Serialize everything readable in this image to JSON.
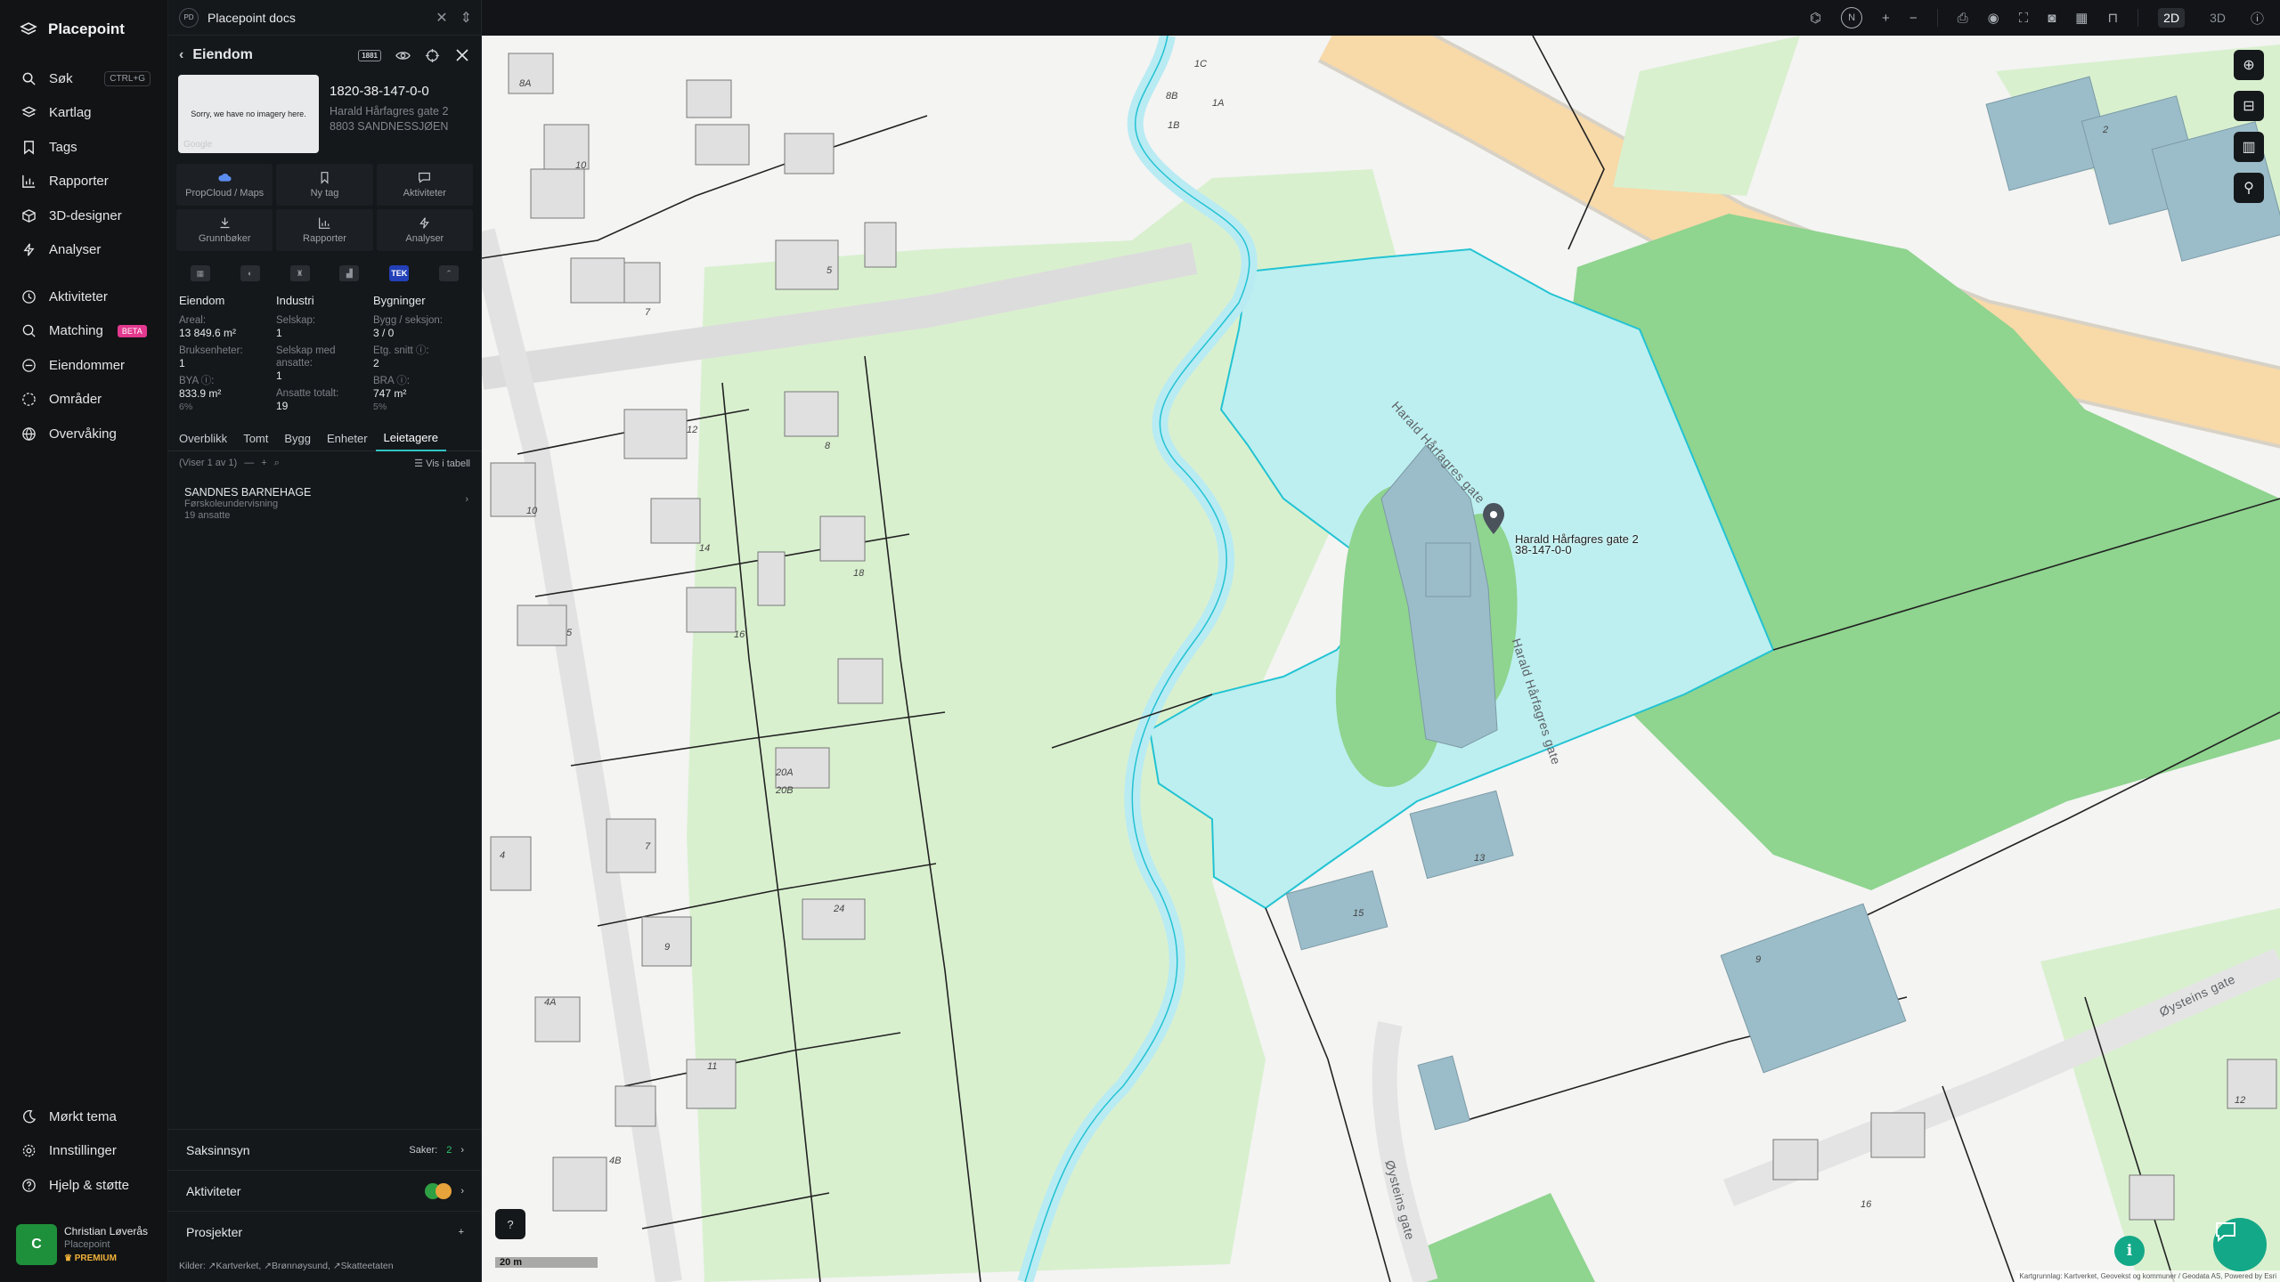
{
  "app": {
    "name": "Placepoint"
  },
  "nav": {
    "items": [
      {
        "label": "Søk",
        "icon": "search-icon",
        "shortcut": "CTRL+G"
      },
      {
        "label": "Kartlag",
        "icon": "layers-icon"
      },
      {
        "label": "Tags",
        "icon": "bookmark-icon"
      },
      {
        "label": "Rapporter",
        "icon": "chart-icon"
      },
      {
        "label": "3D-designer",
        "icon": "cube-icon"
      },
      {
        "label": "Analyser",
        "icon": "bolt-icon"
      }
    ],
    "items2": [
      {
        "label": "Aktiviteter",
        "icon": "activity-icon"
      },
      {
        "label": "Matching",
        "icon": "target-icon",
        "badge": "BETA"
      },
      {
        "label": "Eiendommer",
        "icon": "building-icon"
      },
      {
        "label": "Områder",
        "icon": "area-icon"
      },
      {
        "label": "Overvåking",
        "icon": "globe-icon"
      }
    ],
    "bottom": [
      {
        "label": "Mørkt tema",
        "icon": "moon-icon"
      },
      {
        "label": "Innstillinger",
        "icon": "gear-icon"
      },
      {
        "label": "Hjelp & støtte",
        "icon": "help-icon"
      }
    ],
    "user": {
      "initial": "C",
      "name": "Christian Løverås",
      "org": "Placepoint",
      "plan": "PREMIUM"
    }
  },
  "panel": {
    "tab_badge": "PD",
    "tab_title": "Placepoint docs",
    "header_title": "Eiendom",
    "header_chip": "1881",
    "imagery_text": "Sorry, we have no imagery here.",
    "imagery_logo": "Google",
    "property_id": "1820-38-147-0-0",
    "address_line1": "Harald Hårfagres gate 2",
    "address_line2": "8803 SANDNESSJØEN",
    "actions": [
      {
        "label": "PropCloud / Maps",
        "icon": "cloud-icon"
      },
      {
        "label": "Ny tag",
        "icon": "bookmark-icon"
      },
      {
        "label": "Aktiviteter",
        "icon": "comment-icon"
      },
      {
        "label": "Grunnbøker",
        "icon": "download-icon"
      },
      {
        "label": "Rapporter",
        "icon": "chart-icon"
      },
      {
        "label": "Analyser",
        "icon": "bolt-icon"
      }
    ],
    "datasource_tek": "TEK",
    "stats": {
      "eiendom": {
        "title": "Eiendom",
        "areal_label": "Areal:",
        "areal_value": "13 849.6 m²",
        "bruk_label": "Bruksenheter:",
        "bruk_value": "1",
        "bya_label": "BYA ⓘ:",
        "bya_value": "833.9 m²",
        "bya_pct": "6%"
      },
      "industri": {
        "title": "Industri",
        "selskap_label": "Selskap:",
        "selskap_value": "1",
        "ansatte_label": "Selskap med ansatte:",
        "ansatte_value": "1",
        "total_label": "Ansatte totalt:",
        "total_value": "19"
      },
      "bygninger": {
        "title": "Bygninger",
        "bygg_label": "Bygg / seksjon:",
        "bygg_value": "3 / 0",
        "etg_label": "Etg. snitt ⓘ:",
        "etg_value": "2",
        "bra_label": "BRA ⓘ:",
        "bra_value": "747 m²",
        "bra_pct": "5%"
      }
    },
    "subtabs": [
      "Overblikk",
      "Tomt",
      "Bygg",
      "Enheter",
      "Leietagere"
    ],
    "list_info": "(Viser 1 av 1)",
    "list_view_label": "Vis i tabell",
    "tenant": {
      "name": "SANDNES BARNEHAGE",
      "category": "Førskoleundervisning",
      "employees": "19 ansatte"
    },
    "sections": {
      "saksinnsyn": {
        "label": "Saksinnsyn",
        "count_label": "Saker:",
        "count": "2"
      },
      "aktiviteter": {
        "label": "Aktiviteter"
      },
      "prosjekter": {
        "label": "Prosjekter"
      }
    },
    "sources": {
      "label": "Kilder:",
      "items": [
        "Kartverket",
        "Brønnøysund",
        "Skatteetaten"
      ]
    }
  },
  "topbar": {
    "compass": "N",
    "mode_2d": "2D",
    "mode_3d": "3D"
  },
  "map": {
    "pin_label_line1": "Harald Hårfagres gate 2",
    "pin_label_line2": "38-147-0-0",
    "streets": [
      "Harald Hårfagres gate",
      "Harald Hårfagres gate",
      "Øysteins gate",
      "Øysteins gate"
    ],
    "house_numbers": [
      "8A",
      "8B",
      "1C",
      "1B",
      "1A",
      "10",
      "5",
      "7",
      "2",
      "12",
      "8",
      "10",
      "14",
      "18",
      "16",
      "5",
      "20A",
      "20B",
      "7",
      "4",
      "24",
      "9",
      "4A",
      "11",
      "4B",
      "13",
      "15",
      "9",
      "12",
      "16"
    ],
    "scale_label": "20 m",
    "attribution": "Kartgrunnlag: Kartverket, Geovekst og kommuner / Geodata AS, Powered by Esri",
    "colors": {
      "parcel": "#bdeff0",
      "selected_border": "#22c3d3",
      "building": "#9bbdc9",
      "park": "#8fd48f",
      "road": "#f8d9a8"
    }
  }
}
